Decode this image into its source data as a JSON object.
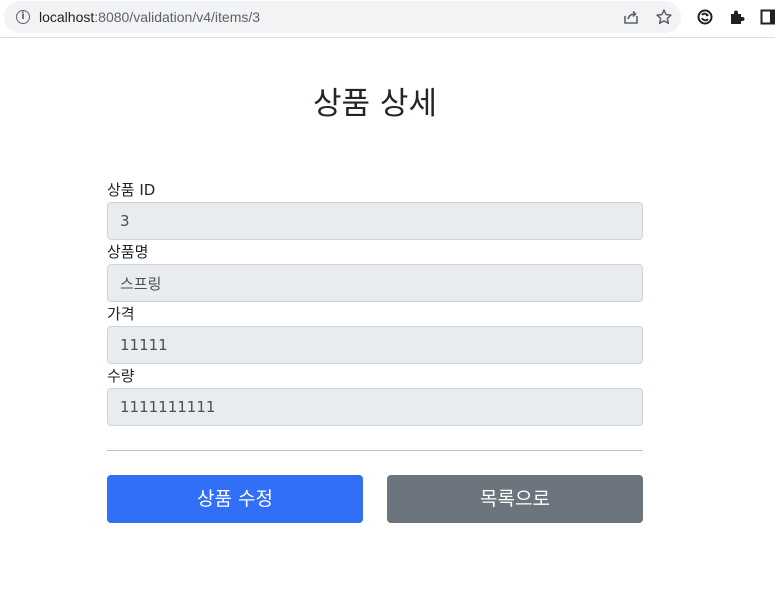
{
  "browser": {
    "url_host": "localhost",
    "url_path": ":8080/validation/v4/items/3",
    "info_glyph": "i"
  },
  "page": {
    "title": "상품 상세"
  },
  "form": {
    "fields": [
      {
        "label": "상품 ID",
        "value": "3"
      },
      {
        "label": "상품명",
        "value": "스프링"
      },
      {
        "label": "가격",
        "value": "11111"
      },
      {
        "label": "수량",
        "value": "1111111111"
      }
    ]
  },
  "actions": {
    "edit_label": "상품 수정",
    "list_label": "목록으로"
  },
  "colors": {
    "primary": "#316ff6",
    "secondary": "#6c757d",
    "readonly_bg": "#e9ecef"
  },
  "icons": [
    "info-icon",
    "share-icon",
    "star-icon",
    "sync-icon",
    "extensions-icon",
    "side-panel-icon"
  ]
}
